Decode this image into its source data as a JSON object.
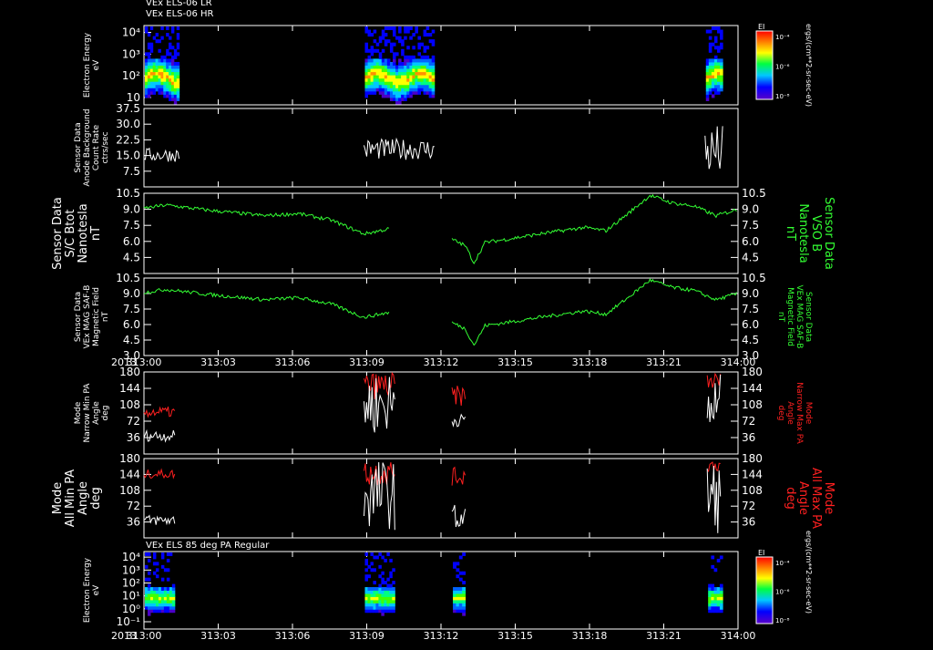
{
  "chart_data": [
    {
      "id": "p1",
      "type": "heatmap",
      "title_lines": [
        "VEx ELS-06 LR",
        "VEx ELS-06 HR"
      ],
      "ylabel_lines": [
        "Electron Energy",
        "eV"
      ],
      "y_scale": "log",
      "yticks": [
        "10",
        "10²",
        "10³",
        "10⁴"
      ],
      "data_intervals": [
        [
          0.0,
          1.6
        ],
        [
          10.0,
          13.2
        ],
        [
          25.5,
          26.3
        ]
      ],
      "colorbar": {
        "title": "EI",
        "labels": [
          "10⁻⁴",
          "10⁻⁶",
          "10⁻⁸"
        ],
        "units": "ergs/(cm**2-sr-sec-eV)"
      }
    },
    {
      "id": "p2",
      "type": "line",
      "ylabel_lines": [
        "Sensor Data",
        "Anode Background",
        "Count Rate",
        "ctrs/sec"
      ],
      "ylim": [
        0,
        37.5
      ],
      "yticks": [
        "7.5",
        "15.0",
        "22.5",
        "30.0",
        "37.5"
      ],
      "series": [
        {
          "color": "#ffffff",
          "segments": [
            {
              "x": [
                0.0,
                1.6
              ],
              "y_range": [
                12.0,
                18.5
              ]
            },
            {
              "x": [
                10.0,
                13.2
              ],
              "y_range": [
                13.0,
                23.0
              ]
            },
            {
              "x": [
                25.5,
                26.3
              ],
              "y_range": [
                4.0,
                30.0
              ]
            }
          ]
        }
      ]
    },
    {
      "id": "p3",
      "type": "line",
      "ylabel_lines": [
        "Sensor Data",
        "S/C Btot",
        "Nanotesla",
        "nT"
      ],
      "ylabel_right_lines": [
        "Sensor Data",
        "VSO B",
        "Nanotesla",
        "nT"
      ],
      "ylim": [
        3.0,
        10.5
      ],
      "yticks": [
        "4.5",
        "6.0",
        "7.5",
        "9.0",
        "10.5"
      ],
      "series": [
        {
          "color": "#33ff33",
          "segments": [
            {
              "x": [
                0.0,
                1.0,
                3.0,
                5.5,
                7.0,
                8.5,
                10.0,
                11.2
              ],
              "y": [
                9.1,
                9.4,
                8.9,
                8.4,
                8.6,
                8.0,
                6.7,
                7.2
              ]
            },
            {
              "x": [
                14.0,
                14.6,
                15.0,
                15.5,
                16.5,
                18.0,
                20.0,
                21.0,
                22.0,
                23.0,
                24.0,
                25.0,
                26.0,
                27.0
              ],
              "y": [
                6.2,
                5.6,
                4.0,
                5.9,
                6.2,
                6.7,
                7.3,
                7.0,
                8.6,
                10.3,
                9.6,
                9.3,
                8.4,
                9.0
              ]
            }
          ]
        }
      ]
    },
    {
      "id": "p4",
      "type": "line",
      "ylabel_lines": [
        "Sensor Data",
        "VEx MAG SAF-B",
        "Magnetic Field",
        "nT"
      ],
      "ylabel_right_lines": [
        "Sensor Data",
        "VEx MAG SAF-B",
        "Magnetic Field",
        "nT"
      ],
      "ylim": [
        3.0,
        10.5
      ],
      "yticks": [
        "3.0",
        "4.5",
        "6.0",
        "7.5",
        "9.0",
        "10.5"
      ],
      "series": [
        {
          "color": "#33ff33",
          "segments": [
            {
              "x": [
                0.0,
                1.0,
                3.0,
                5.5,
                7.0,
                8.5,
                10.0,
                11.2
              ],
              "y": [
                9.1,
                9.4,
                8.9,
                8.4,
                8.6,
                8.0,
                6.7,
                7.2
              ]
            },
            {
              "x": [
                14.0,
                14.6,
                15.0,
                15.5,
                16.5,
                18.0,
                20.0,
                21.0,
                22.0,
                23.0,
                24.0,
                25.0,
                26.0,
                27.0
              ],
              "y": [
                6.2,
                5.6,
                4.0,
                5.9,
                6.2,
                6.7,
                7.3,
                7.0,
                8.6,
                10.3,
                9.6,
                9.3,
                8.4,
                9.0
              ]
            }
          ]
        }
      ]
    },
    {
      "id": "p5",
      "type": "line",
      "ylabel_lines": [
        "Mode",
        "Narrow Min PA",
        "Angle",
        "deg"
      ],
      "ylabel_right_lines": [
        "Mode",
        "Narrow Max PA",
        "Angle",
        "deg"
      ],
      "ylim": [
        0,
        180
      ],
      "yticks": [
        "36",
        "72",
        "108",
        "144",
        "180"
      ],
      "series": [
        {
          "color": "#ff2020",
          "segments": [
            {
              "x": [
                0.0,
                1.4
              ],
              "y_range": [
                80,
                104
              ]
            },
            {
              "x": [
                10.0,
                11.4
              ],
              "y_range": [
                120,
                180
              ]
            },
            {
              "x": [
                14.0,
                14.6
              ],
              "y_range": [
                105,
                150
              ]
            },
            {
              "x": [
                25.6,
                26.2
              ],
              "y_range": [
                140,
                180
              ]
            }
          ]
        },
        {
          "color": "#ffffff",
          "segments": [
            {
              "x": [
                0.0,
                1.4
              ],
              "y_range": [
                28,
                52
              ]
            },
            {
              "x": [
                10.0,
                11.4
              ],
              "y_range": [
                42,
                180
              ]
            },
            {
              "x": [
                14.0,
                14.6
              ],
              "y_range": [
                60,
                88
              ]
            },
            {
              "x": [
                25.6,
                26.2
              ],
              "y_range": [
                20,
                180
              ]
            }
          ]
        }
      ]
    },
    {
      "id": "p6",
      "type": "line",
      "ylabel_lines": [
        "Mode",
        "All Min PA",
        "Angle",
        "deg"
      ],
      "ylabel_right_lines": [
        "Mode",
        "All Max PA",
        "Angle",
        "deg"
      ],
      "ylim": [
        0,
        180
      ],
      "yticks": [
        "36",
        "72",
        "108",
        "144",
        "180"
      ],
      "series": [
        {
          "color": "#ff2020",
          "segments": [
            {
              "x": [
                0.0,
                1.4
              ],
              "y_range": [
                135,
                155
              ]
            },
            {
              "x": [
                10.0,
                11.4
              ],
              "y_range": [
                118,
                178
              ]
            },
            {
              "x": [
                14.0,
                14.6
              ],
              "y_range": [
                118,
                160
              ]
            },
            {
              "x": [
                25.6,
                26.2
              ],
              "y_range": [
                150,
                180
              ]
            }
          ]
        },
        {
          "color": "#ffffff",
          "segments": [
            {
              "x": [
                0.0,
                1.4
              ],
              "y_range": [
                28,
                52
              ]
            },
            {
              "x": [
                10.0,
                11.4
              ],
              "y_range": [
                18,
                180
              ]
            },
            {
              "x": [
                14.0,
                14.6
              ],
              "y_range": [
                14,
                76
              ]
            },
            {
              "x": [
                25.6,
                26.2
              ],
              "y_range": [
                10,
                180
              ]
            }
          ]
        }
      ]
    },
    {
      "id": "p7",
      "type": "heatmap",
      "title_lines": [
        "VEx ELS 85 deg PA Regular"
      ],
      "ylabel_lines": [
        "Electron Energy",
        "eV"
      ],
      "y_scale": "log",
      "yticks": [
        "10⁻¹",
        "10⁰",
        "10¹",
        "10²",
        "10³",
        "10⁴"
      ],
      "data_intervals": [
        [
          0.0,
          1.4
        ],
        [
          10.0,
          11.4
        ],
        [
          14.0,
          14.6
        ],
        [
          25.6,
          26.3
        ]
      ],
      "colorbar": {
        "title": "EI",
        "labels": [
          "10⁻⁴",
          "10⁻⁶",
          "10⁻⁸"
        ],
        "units": "ergs/(cm**2-sr-sec-eV)"
      }
    }
  ],
  "time_axis": {
    "year": "2013",
    "xlim": [
      0,
      27
    ],
    "ticks": [
      {
        "v": 0,
        "label": "313:00"
      },
      {
        "v": 4.5,
        "label": "313:03"
      },
      {
        "v": 9,
        "label": "313:06"
      },
      {
        "v": 13.5,
        "label": "313:09"
      },
      {
        "v": 18,
        "label": "313:12"
      },
      {
        "v": 22.5,
        "label": "313:15"
      },
      {
        "v": 27,
        "label": "313:18"
      }
    ]
  },
  "time_axis_labels_full": [
    "313:00",
    "313:03",
    "313:06",
    "313:09",
    "313:12",
    "313:15",
    "313:18",
    "313:21",
    "314:00"
  ]
}
